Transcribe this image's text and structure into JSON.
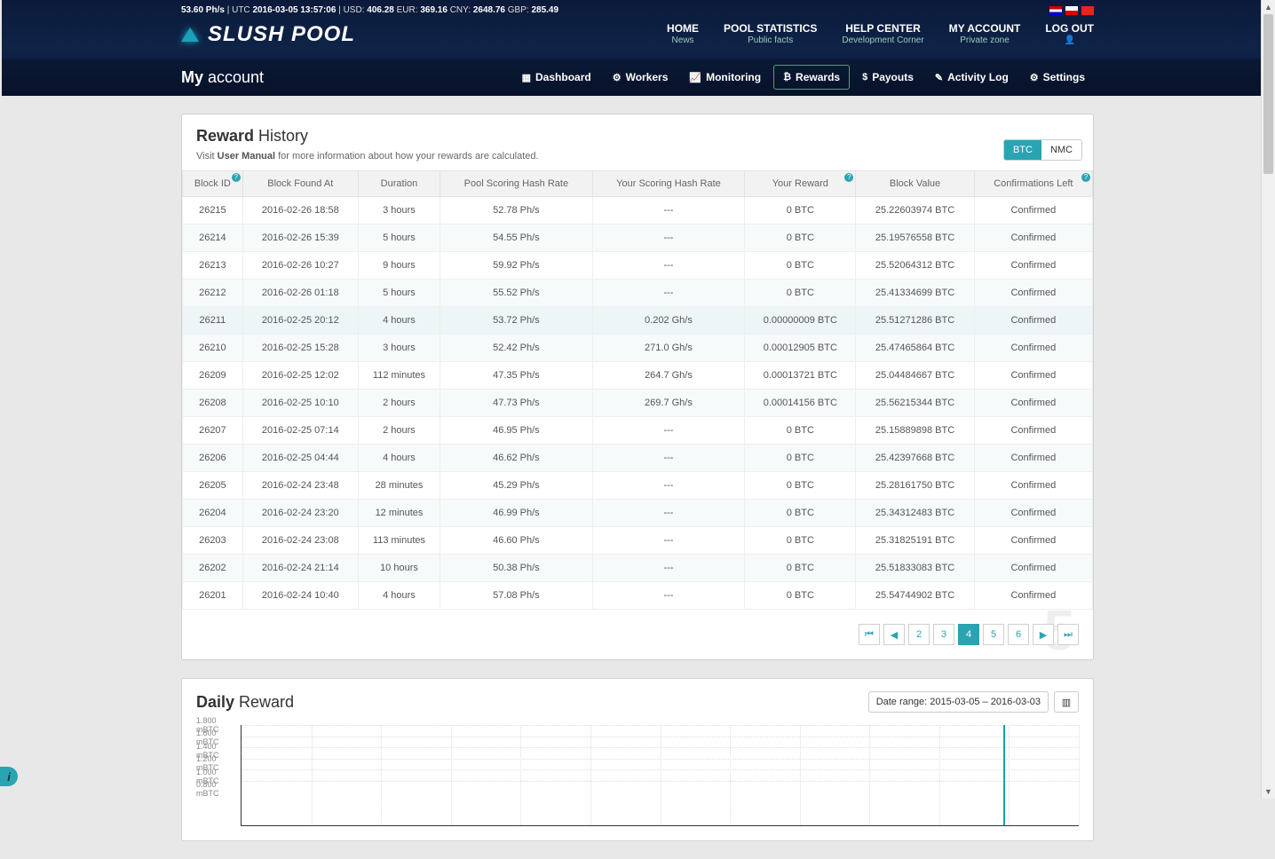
{
  "top": {
    "hash": "53.60 Ph/s",
    "utc_label": "UTC",
    "utc": "2016-03-05 13:57:06",
    "usd_label": "USD:",
    "usd": "406.28",
    "eur_label": "EUR:",
    "eur": "369.16",
    "cny_label": "CNY:",
    "cny": "2648.76",
    "gbp_label": "GBP:",
    "gbp": "285.49"
  },
  "logo": "SLUSH POOL",
  "nav": [
    {
      "t1": "HOME",
      "t2": "News"
    },
    {
      "t1": "POOL STATISTICS",
      "t2": "Public facts"
    },
    {
      "t1": "HELP CENTER",
      "t2": "Development Corner"
    },
    {
      "t1": "MY ACCOUNT",
      "t2": "Private zone"
    },
    {
      "t1": "LOG OUT",
      "t2": "👤"
    }
  ],
  "my_account": {
    "bold": "My",
    "rest": " account"
  },
  "subtabs": [
    {
      "ico": "▦",
      "label": "Dashboard"
    },
    {
      "ico": "⚙",
      "label": "Workers"
    },
    {
      "ico": "📈",
      "label": "Monitoring"
    },
    {
      "ico": "₿",
      "label": "Rewards"
    },
    {
      "ico": "$",
      "label": "Payouts"
    },
    {
      "ico": "✎",
      "label": "Activity Log"
    },
    {
      "ico": "⚙",
      "label": "Settings"
    }
  ],
  "reward_panel": {
    "title_bold": "Reward",
    "title_rest": " History",
    "sub_pre": "Visit ",
    "sub_link": "User Manual",
    "sub_post": " for more information about how your rewards are calculated."
  },
  "coin": {
    "btc": "BTC",
    "nmc": "NMC"
  },
  "cols": [
    "Block ID",
    "Block Found At",
    "Duration",
    "Pool Scoring Hash Rate",
    "Your Scoring Hash Rate",
    "Your Reward",
    "Block Value",
    "Confirmations Left"
  ],
  "rows": [
    {
      "id": "26215",
      "found": "2016-02-26 18:58",
      "dur": "3 hours",
      "pool": "52.78 Ph/s",
      "your": "---",
      "reward": "0 BTC",
      "value": "25.22603974 BTC",
      "conf": "Confirmed",
      "hl": false
    },
    {
      "id": "26214",
      "found": "2016-02-26 15:39",
      "dur": "5 hours",
      "pool": "54.55 Ph/s",
      "your": "---",
      "reward": "0 BTC",
      "value": "25.19576558 BTC",
      "conf": "Confirmed",
      "hl": false
    },
    {
      "id": "26213",
      "found": "2016-02-26 10:27",
      "dur": "9 hours",
      "pool": "59.92 Ph/s",
      "your": "---",
      "reward": "0 BTC",
      "value": "25.52064312 BTC",
      "conf": "Confirmed",
      "hl": false
    },
    {
      "id": "26212",
      "found": "2016-02-26 01:18",
      "dur": "5 hours",
      "pool": "55.52 Ph/s",
      "your": "---",
      "reward": "0 BTC",
      "value": "25.41334699 BTC",
      "conf": "Confirmed",
      "hl": false
    },
    {
      "id": "26211",
      "found": "2016-02-25 20:12",
      "dur": "4 hours",
      "pool": "53.72 Ph/s",
      "your": "0.202 Gh/s",
      "reward": "0.00000009 BTC",
      "value": "25.51271286 BTC",
      "conf": "Confirmed",
      "hl": true
    },
    {
      "id": "26210",
      "found": "2016-02-25 15:28",
      "dur": "3 hours",
      "pool": "52.42 Ph/s",
      "your": "271.0 Gh/s",
      "reward": "0.00012905 BTC",
      "value": "25.47465864 BTC",
      "conf": "Confirmed",
      "hl": false
    },
    {
      "id": "26209",
      "found": "2016-02-25 12:02",
      "dur": "112 minutes",
      "pool": "47.35 Ph/s",
      "your": "264.7 Gh/s",
      "reward": "0.00013721 BTC",
      "value": "25.04484667 BTC",
      "conf": "Confirmed",
      "hl": false
    },
    {
      "id": "26208",
      "found": "2016-02-25 10:10",
      "dur": "2 hours",
      "pool": "47.73 Ph/s",
      "your": "269.7 Gh/s",
      "reward": "0.00014156 BTC",
      "value": "25.56215344 BTC",
      "conf": "Confirmed",
      "hl": false
    },
    {
      "id": "26207",
      "found": "2016-02-25 07:14",
      "dur": "2 hours",
      "pool": "46.95 Ph/s",
      "your": "---",
      "reward": "0 BTC",
      "value": "25.15889898 BTC",
      "conf": "Confirmed",
      "hl": false
    },
    {
      "id": "26206",
      "found": "2016-02-25 04:44",
      "dur": "4 hours",
      "pool": "46.62 Ph/s",
      "your": "---",
      "reward": "0 BTC",
      "value": "25.42397668 BTC",
      "conf": "Confirmed",
      "hl": false
    },
    {
      "id": "26205",
      "found": "2016-02-24 23:48",
      "dur": "28 minutes",
      "pool": "45.29 Ph/s",
      "your": "---",
      "reward": "0 BTC",
      "value": "25.28161750 BTC",
      "conf": "Confirmed",
      "hl": false
    },
    {
      "id": "26204",
      "found": "2016-02-24 23:20",
      "dur": "12 minutes",
      "pool": "46.99 Ph/s",
      "your": "---",
      "reward": "0 BTC",
      "value": "25.34312483 BTC",
      "conf": "Confirmed",
      "hl": false
    },
    {
      "id": "26203",
      "found": "2016-02-24 23:08",
      "dur": "113 minutes",
      "pool": "46.60 Ph/s",
      "your": "---",
      "reward": "0 BTC",
      "value": "25.31825191 BTC",
      "conf": "Confirmed",
      "hl": false
    },
    {
      "id": "26202",
      "found": "2016-02-24 21:14",
      "dur": "10 hours",
      "pool": "50.38 Ph/s",
      "your": "---",
      "reward": "0 BTC",
      "value": "25.51833083 BTC",
      "conf": "Confirmed",
      "hl": false
    },
    {
      "id": "26201",
      "found": "2016-02-24 10:40",
      "dur": "4 hours",
      "pool": "57.08 Ph/s",
      "your": "---",
      "reward": "0 BTC",
      "value": "25.54744902 BTC",
      "conf": "Confirmed",
      "hl": false
    }
  ],
  "pager": {
    "pages": [
      "2",
      "3",
      "4",
      "5",
      "6"
    ],
    "active": "4",
    "big": "5"
  },
  "daily": {
    "title_bold": "Daily",
    "title_rest": " Reward",
    "range": "Date range: 2015-03-05 – 2016-03-03"
  },
  "chart_data": {
    "type": "bar",
    "title": "Daily Reward",
    "xlabel": "",
    "ylabel": "mBTC",
    "ylim": [
      0,
      1.8
    ],
    "yticks": [
      {
        "v": 1.8,
        "label": "1.800 mBTC"
      },
      {
        "v": 1.6,
        "label": "1.600 mBTC"
      },
      {
        "v": 1.4,
        "label": "1.400 mBTC"
      },
      {
        "v": 1.2,
        "label": "1.200 mBTC"
      },
      {
        "v": 1.0,
        "label": "1.000 mBTC"
      },
      {
        "v": 0.8,
        "label": "0.800 mBTC"
      }
    ],
    "x_range": [
      "2015-03-05",
      "2016-03-03"
    ],
    "series": [
      {
        "name": "Daily Reward",
        "bars": [
          {
            "x_frac": 0.91,
            "value": 1.8
          }
        ]
      }
    ]
  }
}
